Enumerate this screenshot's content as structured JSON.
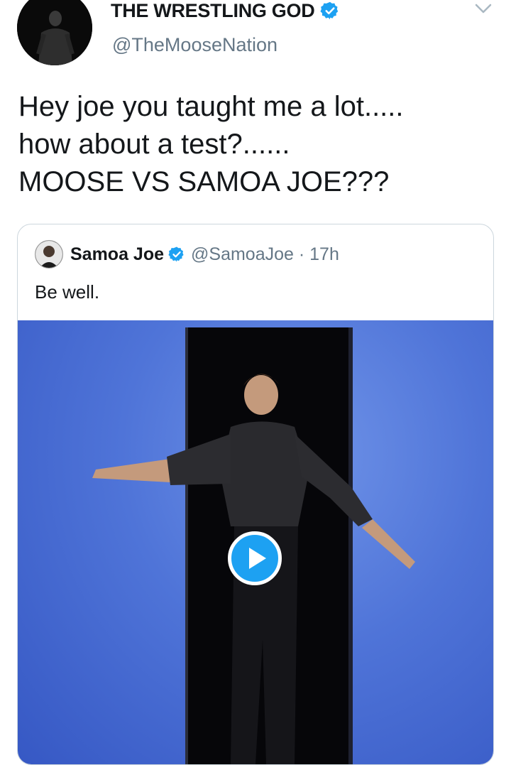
{
  "tweet": {
    "display_name": "THE WRESTLING GOD",
    "handle": "@TheMooseNation",
    "text_lines": [
      "Hey joe you taught me a lot.....",
      "how about a test?......",
      "MOOSE VS SAMOA JOE???"
    ]
  },
  "quoted_tweet": {
    "display_name": "Samoa Joe",
    "handle_time": "@SamoaJoe · 17h",
    "text": "Be well."
  },
  "colors": {
    "accent": "#1da1f2",
    "secondary_text": "#657786",
    "border": "#ccd6dd"
  },
  "icons": [
    "verified-badge-icon",
    "chevron-down-icon",
    "play-icon"
  ]
}
